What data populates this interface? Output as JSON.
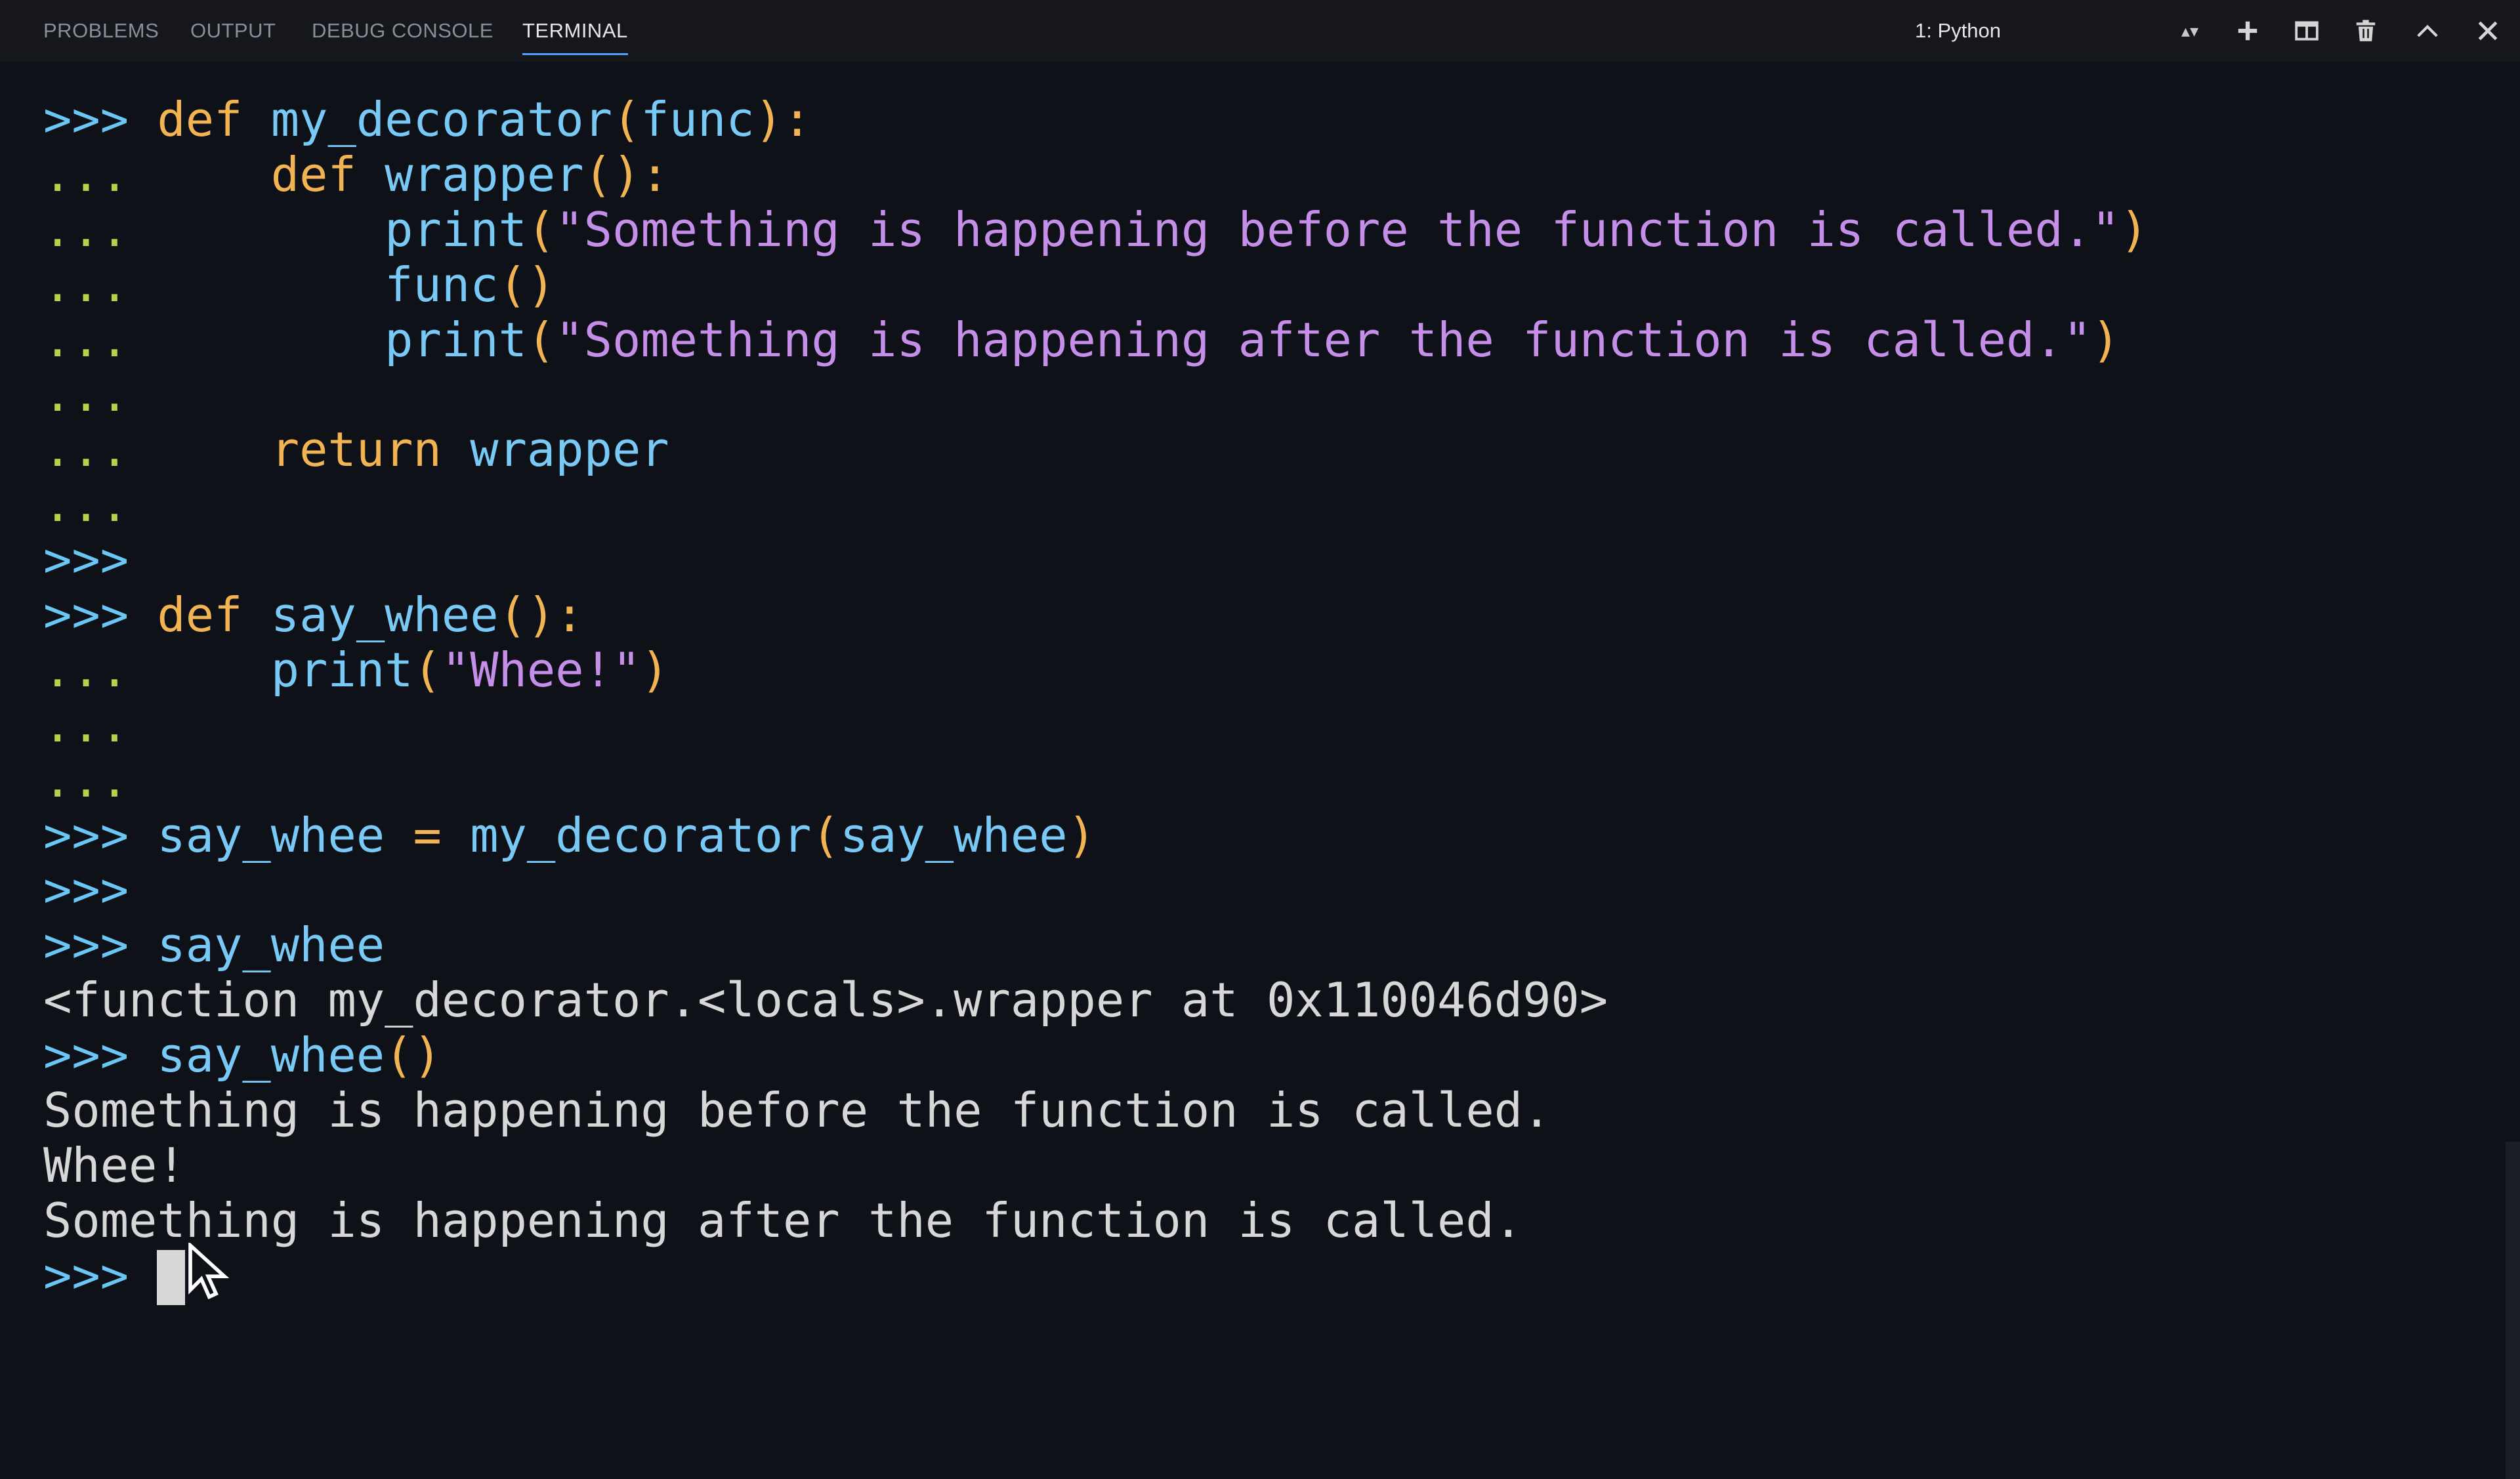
{
  "panel": {
    "tabs": [
      "PROBLEMS",
      "OUTPUT",
      "DEBUG CONSOLE",
      "TERMINAL"
    ],
    "active_tab": "TERMINAL",
    "terminal_selector": "1: Python",
    "toolbar_icons": [
      "plus-icon",
      "split-icon",
      "trash-icon",
      "chevron-up-icon",
      "close-icon"
    ]
  },
  "terminal": {
    "lines": [
      {
        "prompt": ">>> ",
        "parts": [
          [
            "kw",
            "def "
          ],
          [
            "fn",
            "my_decorator"
          ],
          [
            "pn",
            "("
          ],
          [
            "fn",
            "func"
          ],
          [
            "pn",
            "):"
          ]
        ]
      },
      {
        "prompt": "...     ",
        "parts": [
          [
            "kw",
            "def "
          ],
          [
            "fn",
            "wrapper"
          ],
          [
            "pn",
            "():"
          ]
        ]
      },
      {
        "prompt": "...         ",
        "parts": [
          [
            "fn",
            "print"
          ],
          [
            "pn",
            "("
          ],
          [
            "st",
            "\"Something is happening before the function is called.\""
          ],
          [
            "pn",
            ")"
          ]
        ]
      },
      {
        "prompt": "...         ",
        "parts": [
          [
            "fn",
            "func"
          ],
          [
            "pn",
            "()"
          ]
        ]
      },
      {
        "prompt": "...         ",
        "parts": [
          [
            "fn",
            "print"
          ],
          [
            "pn",
            "("
          ],
          [
            "st",
            "\"Something is happening after the function is called.\""
          ],
          [
            "pn",
            ")"
          ]
        ]
      },
      {
        "prompt": "...",
        "parts": []
      },
      {
        "prompt": "...     ",
        "parts": [
          [
            "kw",
            "return "
          ],
          [
            "fn",
            "wrapper"
          ]
        ]
      },
      {
        "prompt": "...",
        "parts": []
      },
      {
        "prompt": ">>>",
        "parts": []
      },
      {
        "prompt": ">>> ",
        "parts": [
          [
            "kw",
            "def "
          ],
          [
            "fn",
            "say_whee"
          ],
          [
            "pn",
            "():"
          ]
        ]
      },
      {
        "prompt": "...     ",
        "parts": [
          [
            "fn",
            "print"
          ],
          [
            "pn",
            "("
          ],
          [
            "st",
            "\"Whee!\""
          ],
          [
            "pn",
            ")"
          ]
        ]
      },
      {
        "prompt": "...",
        "parts": []
      },
      {
        "prompt": "...",
        "parts": []
      },
      {
        "prompt": ">>> ",
        "parts": [
          [
            "fn",
            "say_whee "
          ],
          [
            "kw",
            "= "
          ],
          [
            "fn",
            "my_decorator"
          ],
          [
            "pn",
            "("
          ],
          [
            "fn",
            "say_whee"
          ],
          [
            "pn",
            ")"
          ]
        ]
      },
      {
        "prompt": ">>>",
        "parts": []
      },
      {
        "prompt": ">>> ",
        "parts": [
          [
            "fn",
            "say_whee"
          ]
        ]
      },
      {
        "prompt": "",
        "parts": [
          [
            "out",
            "<function my_decorator.<locals>.wrapper at 0x110046d90>"
          ]
        ]
      },
      {
        "prompt": ">>> ",
        "parts": [
          [
            "fn",
            "say_whee"
          ],
          [
            "pn",
            "()"
          ]
        ]
      },
      {
        "prompt": "",
        "parts": [
          [
            "out",
            "Something is happening before the function is called."
          ]
        ]
      },
      {
        "prompt": "",
        "parts": [
          [
            "out",
            "Whee!"
          ]
        ]
      },
      {
        "prompt": "",
        "parts": [
          [
            "out",
            "Something is happening after the function is called."
          ]
        ]
      }
    ],
    "current_prompt": ">>> "
  },
  "colors": {
    "background": "#0e1117",
    "prompt": "#6ac7f5",
    "continuation": "#b7d14a",
    "keyword": "#f2b352",
    "identifier": "#78c9f5",
    "string": "#c58ee8",
    "output": "#d7d7d7"
  }
}
